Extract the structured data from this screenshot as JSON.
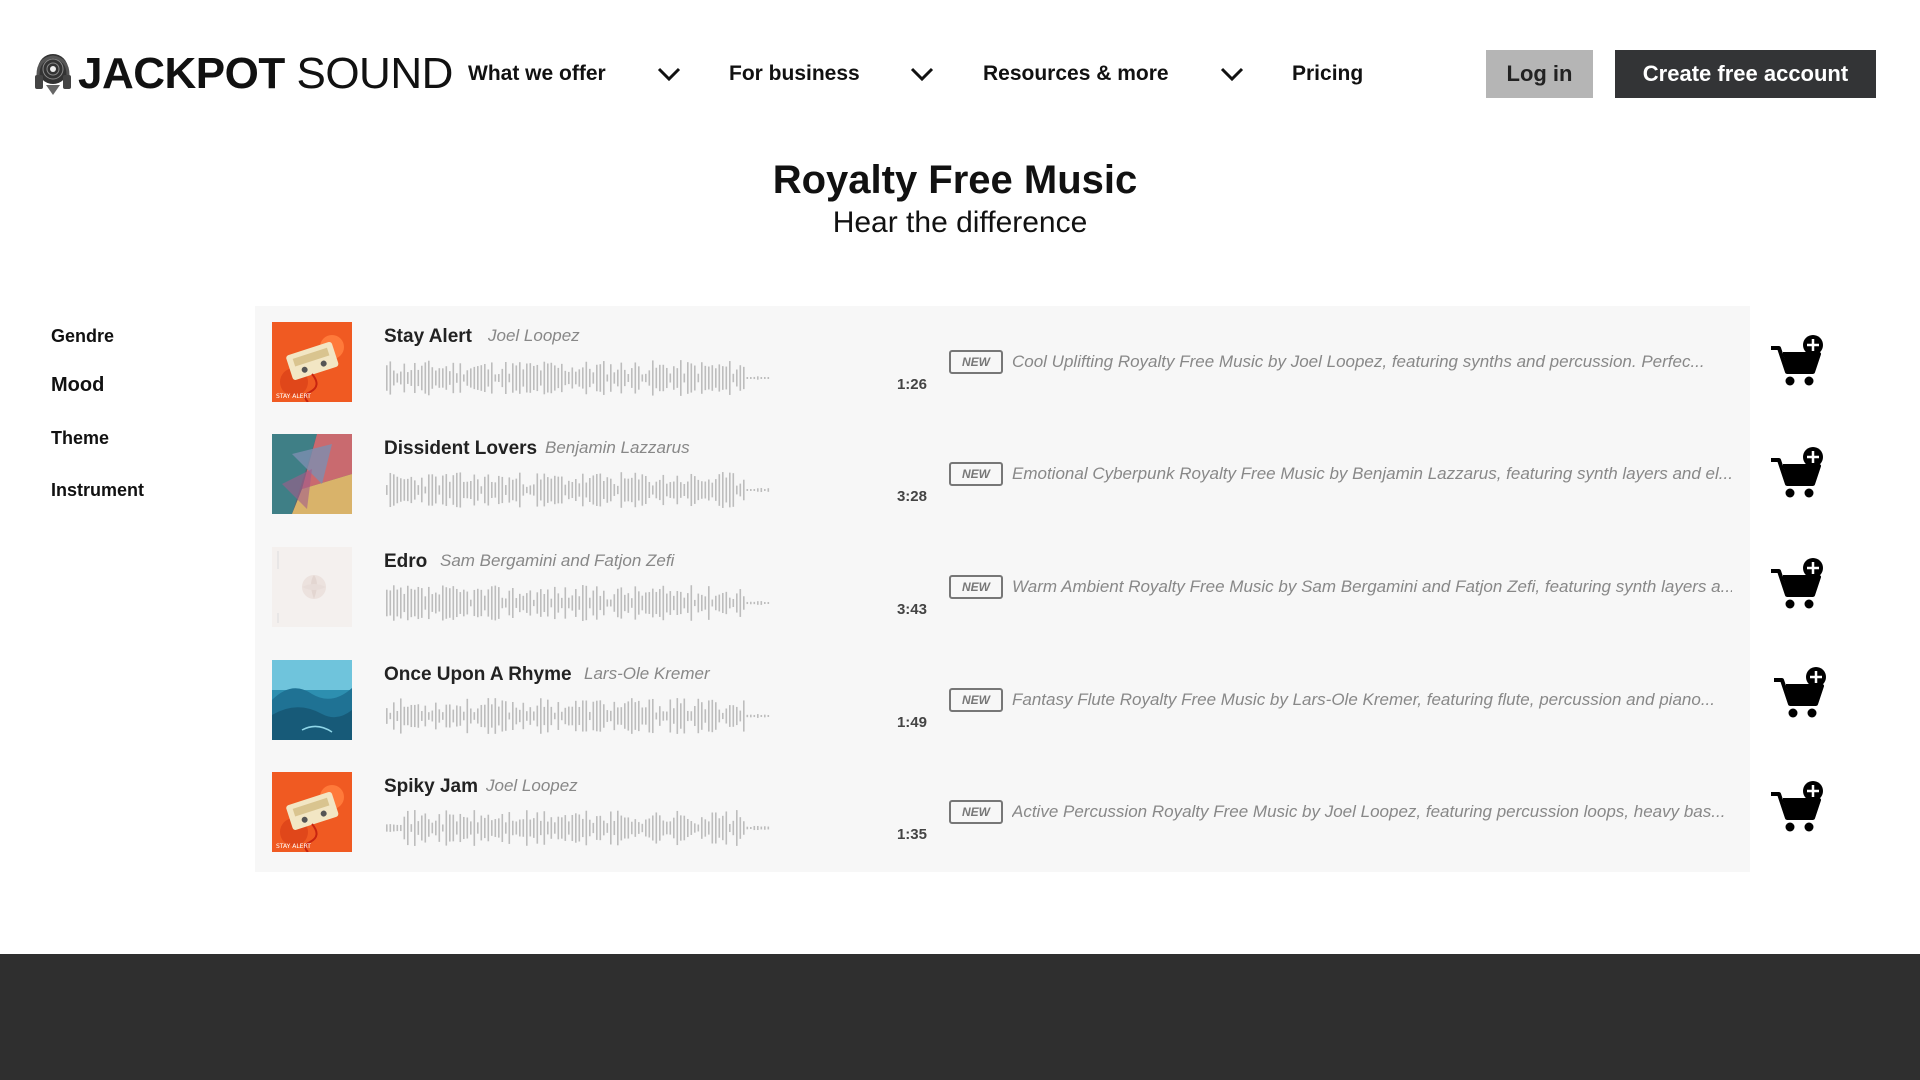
{
  "brand": {
    "name_bold": "JACKPOT",
    "name_light": "SOUND"
  },
  "nav": {
    "items": [
      {
        "label": "What we offer"
      },
      {
        "label": "For business"
      },
      {
        "label": "Resources & more"
      },
      {
        "label": "Pricing"
      }
    ],
    "login_label": "Log in",
    "create_label": "Create free account"
  },
  "hero": {
    "title": "Royalty Free Music",
    "subtitle": "Hear the difference"
  },
  "filters": [
    {
      "label": "Gendre",
      "active": false
    },
    {
      "label": "Mood",
      "active": true
    },
    {
      "label": "Theme",
      "active": false
    },
    {
      "label": "Instrument",
      "active": false
    }
  ],
  "tracks": [
    {
      "title": "Stay Alert",
      "artist": "Joel Loopez",
      "duration": "1:26",
      "badge": "NEW",
      "description": "Cool Uplifting Royalty Free Music by Joel Loopez, featuring synths and percussion. Perfec..."
    },
    {
      "title": "Dissident Lovers",
      "artist": "Benjamin Lazzarus",
      "duration": "3:28",
      "badge": "NEW",
      "description": "Emotional Cyberpunk Royalty Free Music by Benjamin Lazzarus, featuring synth layers and el..."
    },
    {
      "title": "Edro",
      "artist": "Sam Bergamini and Fatjon Zefi",
      "duration": "3:43",
      "badge": "NEW",
      "description": "Warm Ambient Royalty Free Music by Sam Bergamini and Fatjon Zefi, featuring synth layers a..."
    },
    {
      "title": "Once Upon A Rhyme",
      "artist": "Lars-Ole Kremer",
      "duration": "1:49",
      "badge": "NEW",
      "description": "Fantasy Flute Royalty Free Music by Lars-Ole Kremer, featuring flute, percussion and piano..."
    },
    {
      "title": "Spiky Jam",
      "artist": "Joel Loopez",
      "duration": "1:35",
      "badge": "NEW",
      "description": "Active Percussion Royalty Free Music by Joel Loopez, featuring percussion loops, heavy bas..."
    }
  ],
  "colors": {
    "primary_dark": "#333436",
    "login_bg": "#b5b5b5",
    "list_bg": "#f7f7f7",
    "footer_bg": "#2f2f2f",
    "muted_text": "#888888"
  },
  "icons": {
    "nav_dropdown": "chevron-down-icon",
    "add_to_cart": "cart-plus-icon",
    "logo": "vinyl-headphones-icon"
  }
}
